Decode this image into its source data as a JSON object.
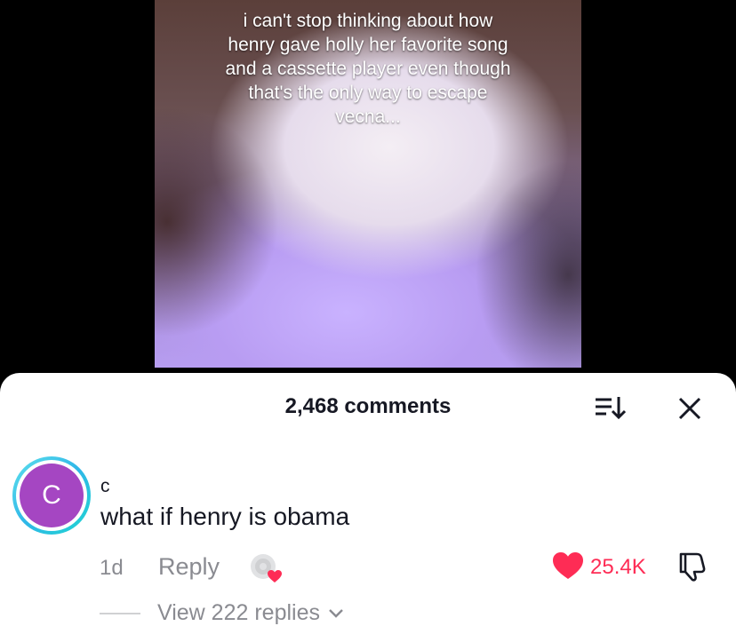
{
  "video": {
    "caption": "i can't stop thinking about how\nhenry gave holly her favorite song\nand a cassette player even though\nthat's the only way to escape\nvecna..."
  },
  "comments_sheet": {
    "title": "2,468 comments",
    "icons": {
      "sort": "sort-icon",
      "close": "close-icon"
    }
  },
  "comment": {
    "avatar_letter": "C",
    "avatar_color": "#a546c2",
    "ring_color": "#2fb7e8",
    "username": "c",
    "text": "what if henry is obama",
    "timestamp": "1d",
    "reply_label": "Reply",
    "like_count": "25.4K",
    "like_color": "#fe2c55",
    "view_replies_label": "View 222 replies",
    "icons": {
      "gift": "gift-icon",
      "like": "heart-icon",
      "dislike": "thumbs-down-icon",
      "expand": "chevron-down-icon"
    }
  }
}
